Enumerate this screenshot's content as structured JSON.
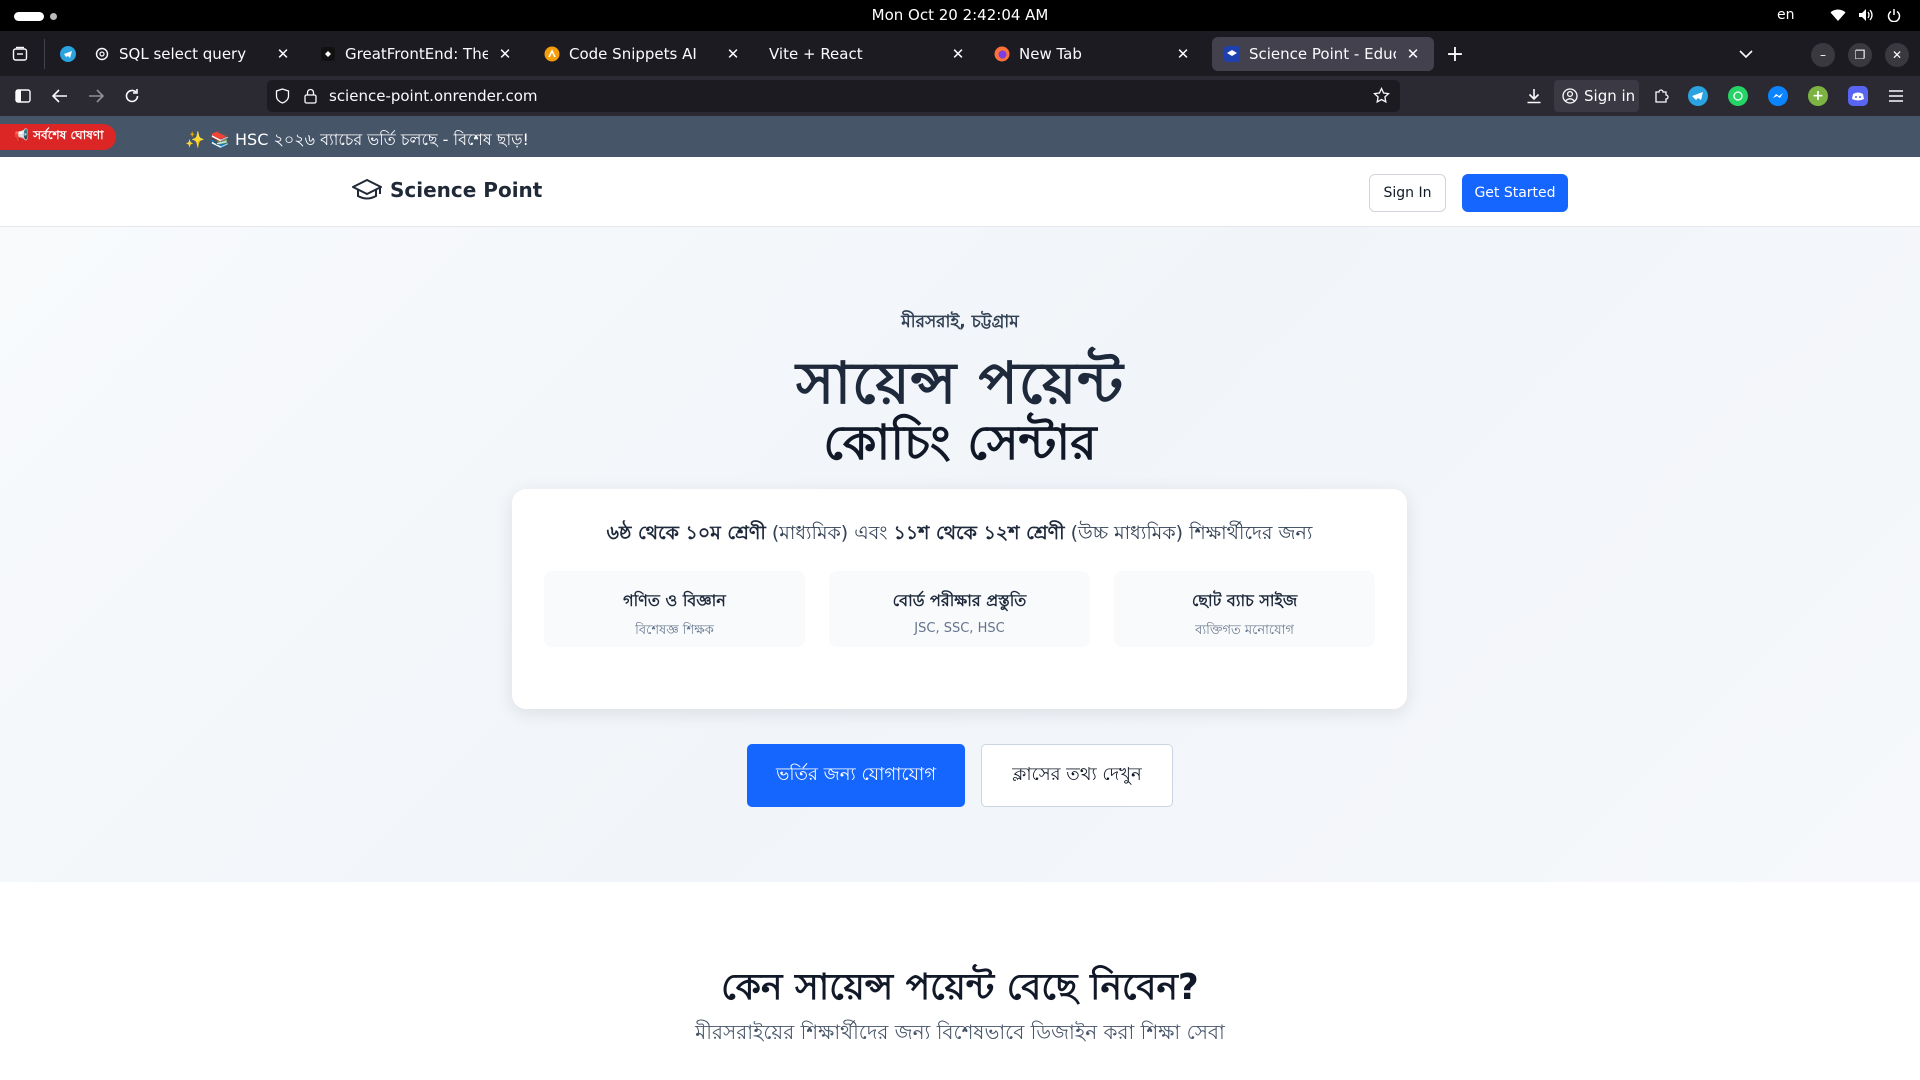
{
  "system": {
    "clock": "Mon Oct 20    2:42:04 AM",
    "language": "en"
  },
  "browser": {
    "tabs": [
      {
        "label": "SQL select query",
        "icon": "openai-icon",
        "active": false
      },
      {
        "label": "GreatFrontEnd: The great",
        "icon": "greatfrontend-icon",
        "active": false
      },
      {
        "label": "Code Snippets AI",
        "icon": "code-snippets-icon",
        "active": false
      },
      {
        "label": "Vite + React",
        "icon": "",
        "active": false
      },
      {
        "label": "New Tab",
        "icon": "firefox-icon",
        "active": false
      },
      {
        "label": "Science Point - Education",
        "icon": "site-icon",
        "active": true
      }
    ],
    "url": "science-point.onrender.com",
    "signin_label": "Sign in"
  },
  "page": {
    "announcement": {
      "badge": "📢 সর্বশেষ ঘোষণা",
      "message": "✨ 📚 HSC ২০২৬ ব্যাচের ভর্তি চলছে - বিশেষ ছাড়!"
    },
    "header": {
      "brand": "Science Point",
      "signin": "Sign In",
      "get_started": "Get Started"
    },
    "hero": {
      "eyebrow": "মীরসরাই, চট্টগ্রাম",
      "title_line1": "সায়েন্স পয়েন্ট",
      "title_line2": "কোচিং সেন্টার",
      "subtitle_part1": "৬ষ্ঠ থেকে ১০ম শ্রেণী",
      "subtitle_part2": " (মাধ্যমিক) এবং ",
      "subtitle_part3": "১১শ থেকে ১২শ শ্রেণী",
      "subtitle_part4": " (উচ্চ মাধ্যমিক) শিক্ষার্থীদের জন্য",
      "features": [
        {
          "title": "গণিত ও বিজ্ঞান",
          "subtitle": "বিশেষজ্ঞ শিক্ষক"
        },
        {
          "title": "বোর্ড পরীক্ষার প্রস্তুতি",
          "subtitle": "JSC, SSC, HSC"
        },
        {
          "title": "ছোট ব্যাচ সাইজ",
          "subtitle": "ব্যক্তিগত মনোযোগ"
        }
      ],
      "cta_primary": "ভর্তির জন্য যোগাযোগ",
      "cta_secondary": "ক্লাসের তথ্য দেখুন"
    },
    "why": {
      "title": "কেন সায়েন্স পয়েন্ট বেছে নিবেন?",
      "subtitle": "মীরসরাইয়ের শিক্ষার্থীদের জন্য বিশেষভাবে ডিজাইন করা শিক্ষা সেবা"
    }
  },
  "colors": {
    "primary": "#1565ff",
    "announcement_bg": "#475569",
    "badge": "#dc2626",
    "browser_dark": "#1c1b22"
  }
}
